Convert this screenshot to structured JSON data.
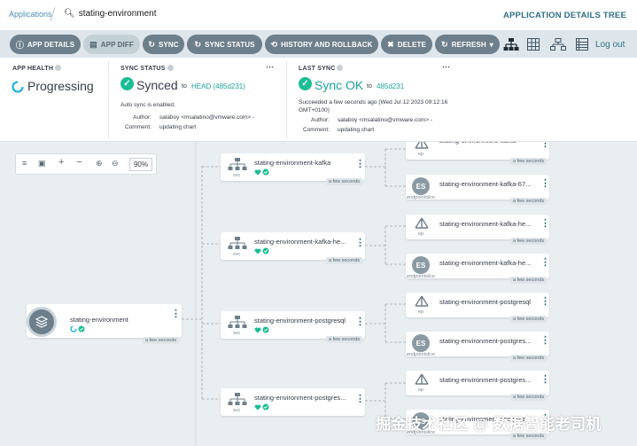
{
  "header": {
    "breadcrumb_applications": "Applications",
    "breadcrumb_app": "stating-environment",
    "details_tree": "APPLICATION DETAILS TREE"
  },
  "toolbar": {
    "app_details": "APP DETAILS",
    "app_diff": "APP DIFF",
    "sync": "SYNC",
    "sync_status": "SYNC STATUS",
    "history": "HISTORY AND ROLLBACK",
    "delete": "DELETE",
    "refresh": "REFRESH",
    "logout": "Log out"
  },
  "app_health": {
    "title": "APP HEALTH",
    "status": "Progressing"
  },
  "sync_status": {
    "title": "SYNC STATUS",
    "status": "Synced",
    "to": "to",
    "revision": "HEAD (485d231)",
    "auto_sync": "Auto sync is enabled.",
    "author_label": "Author:",
    "author": "salaboy <msalatino@vmware.com> -",
    "comment_label": "Comment:",
    "comment": "updating chart"
  },
  "last_sync": {
    "title": "LAST SYNC",
    "status": "Sync OK",
    "to": "to",
    "revision": "485d231",
    "succeeded_line1": "Succeeded a few seconds ago (Wed Jul 12 2023 09:12:16",
    "succeeded_line2": "GMT+0100)",
    "author_label": "Author:",
    "author": "salaboy <msalatino@vmware.com> -",
    "comment_label": "Comment:",
    "comment": "updating chart"
  },
  "graph": {
    "zoom": "90%",
    "root": {
      "name": "stating-environment",
      "time": "a few seconds"
    },
    "services": [
      {
        "name": "stating-environment-kafka",
        "kind": "svc",
        "time": "a few seconds"
      },
      {
        "name": "stating-environment-kafka-he...",
        "kind": "svc",
        "time": "a few seconds"
      },
      {
        "name": "stating-environment-postgresql",
        "kind": "svc",
        "time": "a few seconds"
      },
      {
        "name": "stating-environment-postgres...",
        "kind": "svc",
        "time": ""
      }
    ],
    "children": [
      {
        "name": "stating-environment-kafka",
        "kind": "ep",
        "time": "a few seconds",
        "icon": "ep"
      },
      {
        "name": "stating-environment-kafka-67...",
        "kind": "endpointslice",
        "time": "a few seconds",
        "icon": "es"
      },
      {
        "name": "stating-environment-kafka-he...",
        "kind": "ep",
        "time": "a few seconds",
        "icon": "ep"
      },
      {
        "name": "stating-environment-kafka-he...",
        "kind": "endpointslice",
        "time": "a few seconds",
        "icon": "es"
      },
      {
        "name": "stating-environment-postgresql",
        "kind": "ep",
        "time": "a few seconds",
        "icon": "ep"
      },
      {
        "name": "stating-environment-postgres...",
        "kind": "endpointslice",
        "time": "a few seconds",
        "icon": "es"
      },
      {
        "name": "stating-environment-postgres...",
        "kind": "ep",
        "time": "a few seconds",
        "icon": "ep"
      },
      {
        "name": "stating-environment-postgres...",
        "kind": "endpointslice",
        "time": "a few seconds",
        "icon": "es"
      }
    ],
    "es_label": "ES"
  },
  "watermark": "掘金技术社区 @ 数据智能老司机",
  "colors": {
    "teal": "#1aa39a",
    "green": "#18be94",
    "toolbar_button": "#6d7f8b",
    "link": "#2f6f8a"
  }
}
